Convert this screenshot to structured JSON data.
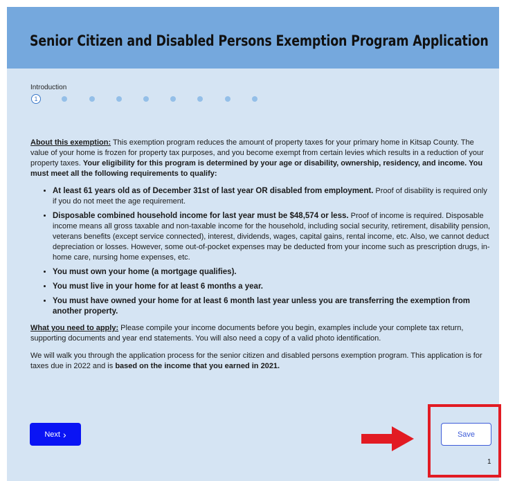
{
  "header": {
    "title": "Senior Citizen and Disabled Persons Exemption Program Application"
  },
  "stepper": {
    "label": "Introduction",
    "current_step": "1",
    "total_steps": 9
  },
  "intro": {
    "about_heading": "About this exemption:",
    "about_text": " This exemption program reduces the amount of property taxes for your primary home in Kitsap County. The value of your home is frozen for property tax purposes, and you become exempt from certain levies which results in a reduction of your property taxes. ",
    "eligibility_text": " Your eligibility for this program is determined by your age or disability, ownership, residency, and income.  You must meet all the following requirements to qualify:"
  },
  "requirements": [
    {
      "bold": "At least 61 years old as of December 31st of last year OR disabled from employment.",
      "text": "  Proof of disability is required only if you do not meet the age requirement."
    },
    {
      "bold": "Disposable combined household income for last year must be $48,574 or less.",
      "text": " Proof of income is required. Disposable income means all gross taxable and non-taxable income for the household, including social security, retirement, disability pension, veterans benefits (except service connected), interest, dividends, wages, capital gains, rental income, etc. Also, we cannot deduct depreciation or losses. However, some out-of-pocket expenses may be deducted from your income such as prescription drugs, in-home care, nursing home expenses, etc."
    },
    {
      "bold": "You must own your home (a mortgage qualifies).",
      "text": ""
    },
    {
      "bold": "You must live in your home for at least 6 months a year.",
      "text": ""
    },
    {
      "bold": "You must have owned your home for at least 6 month last year unless you are transferring the exemption from another property.",
      "text": ""
    }
  ],
  "need": {
    "heading": "What you need to apply:",
    "text": " Please compile your income documents before you begin, examples include your complete tax return, supporting documents and year end statements.  You will also need a copy of a valid photo identification."
  },
  "walk": {
    "text": "We will walk you through the application process for the senior citizen and disabled persons exemption program.  This application is for taxes due in 2022 and is ",
    "bold": "based on the income that you earned in 2021."
  },
  "footer": {
    "next_label": "Next",
    "next_icon": "chevron-right-icon",
    "save_label": "Save",
    "page_number": "1"
  },
  "annotation": {
    "arrow_color": "#e21b23",
    "box_color": "#e21b23"
  },
  "colors": {
    "header_bg": "#75a8dd",
    "page_bg": "#d5e4f3",
    "next_bg": "#0a14f4",
    "save_border": "#3d5bd8"
  }
}
